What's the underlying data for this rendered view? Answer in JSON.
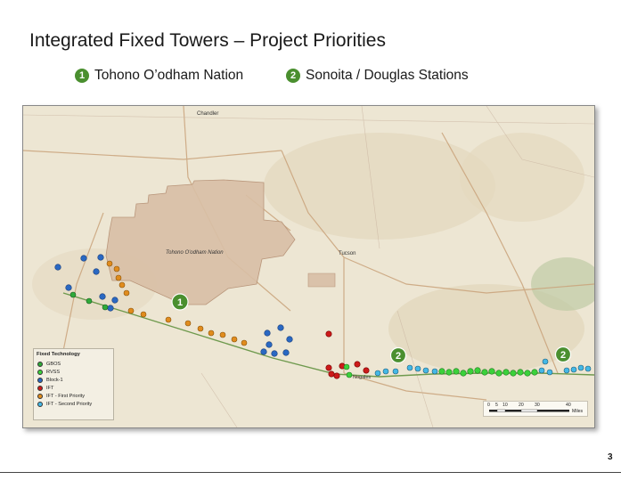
{
  "slide": {
    "title": "Integrated Fixed Towers – Project Priorities",
    "page_number": "3"
  },
  "priorities": [
    {
      "number": "1",
      "label": "Tohono O’odham Nation",
      "color": "#4a8f2f"
    },
    {
      "number": "2",
      "label": "Sonoita / Douglas Stations",
      "color": "#4a8f2f"
    }
  ],
  "map": {
    "region_label": "Tohono O'odham Nation",
    "places": {
      "chandler": "Chandler",
      "tucson": "Tucson",
      "nogales": "Nogales"
    },
    "map_badges": [
      "1",
      "2",
      "2"
    ],
    "legend": {
      "title": "Fixed Technology",
      "items": [
        {
          "label": "GBOS",
          "color": "#2faa3a"
        },
        {
          "label": "RVSS",
          "color": "#3bd13b"
        },
        {
          "label": "Block-1",
          "color": "#2a68c2"
        },
        {
          "label": "IFT",
          "color": "#cc1a1a"
        },
        {
          "label": "IFT - First Priority",
          "color": "#e08c1e"
        },
        {
          "label": "IFT - Second Priority",
          "color": "#44b8e6"
        }
      ]
    },
    "scale": {
      "ticks": [
        "0",
        "5",
        "10",
        "20",
        "30",
        "40"
      ],
      "unit": "Miles"
    },
    "colors": {
      "nation_fill": "#d9bfa6",
      "border_line": "#6f9a4e"
    }
  }
}
